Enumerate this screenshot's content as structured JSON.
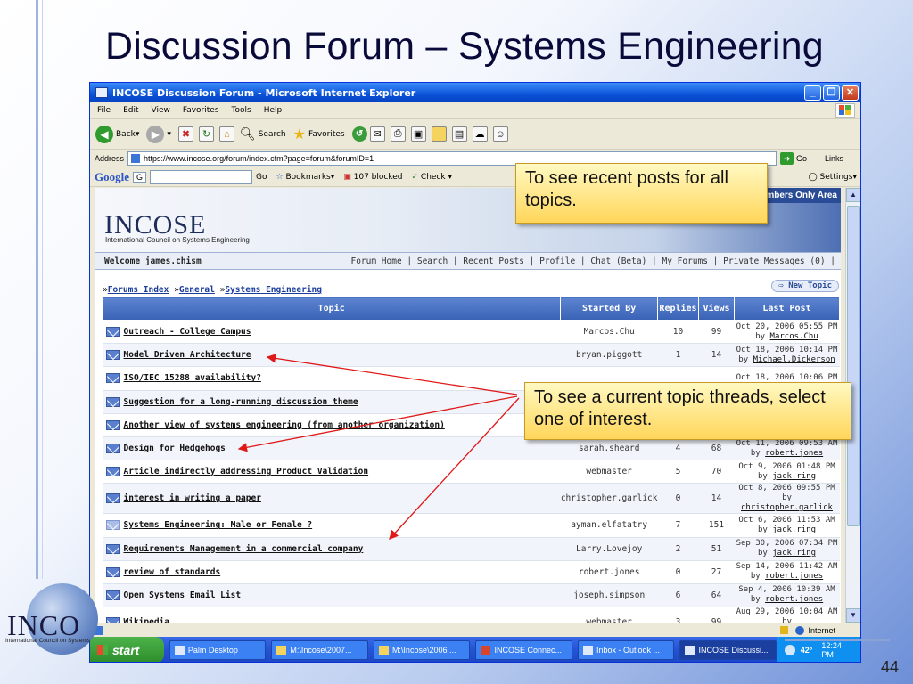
{
  "slide": {
    "title": "Discussion Forum – Systems Engineering",
    "page_number": "44",
    "logo_text": "INCO",
    "logo_subtitle": "International Council on Systems"
  },
  "browser": {
    "window_title": "INCOSE Discussion Forum - Microsoft Internet Explorer",
    "menu": [
      "File",
      "Edit",
      "View",
      "Favorites",
      "Tools",
      "Help"
    ],
    "toolbar": {
      "back": "Back",
      "search": "Search",
      "favorites": "Favorites"
    },
    "address_label": "Address",
    "address_url": "https://www.incose.org/forum/index.cfm?page=forum&forumID=1",
    "go_label": "Go",
    "links_label": "Links",
    "google": {
      "logo": "Google",
      "field_prefix": "G",
      "go": "Go",
      "bookmarks": "Bookmarks",
      "blocked": "107 blocked",
      "check": "Check",
      "settings": "Settings"
    }
  },
  "site": {
    "members_only": "Members Only Area",
    "logo": "INCOSE",
    "logo_subtitle": "International Council on Systems Engineering",
    "welcome": "Welcome james.chism",
    "nav_links": [
      "Forum Home",
      "Search",
      "Recent Posts",
      "Profile",
      "Chat (Beta)",
      "My Forums",
      "Private Messages"
    ],
    "private_count": "(0)",
    "breadcrumb": [
      "Forums Index",
      "General",
      "Systems Engineering"
    ],
    "new_topic": "New Topic",
    "columns": [
      "Topic",
      "Started By",
      "Replies",
      "Views",
      "Last Post"
    ],
    "topics": [
      {
        "title": "Outreach - College Campus",
        "started_by": "Marcos.Chu",
        "replies": "10",
        "views": "99",
        "last_date": "Oct 20, 2006 05:55 PM",
        "last_by": "Marcos.Chu",
        "read": false
      },
      {
        "title": "Model Driven Architecture",
        "started_by": "bryan.piggott",
        "replies": "1",
        "views": "14",
        "last_date": "Oct 18, 2006 10:14 PM",
        "last_by": "Michael.Dickerson",
        "read": false
      },
      {
        "title": "ISO/IEC 15288 availability?",
        "started_by": "",
        "replies": "",
        "views": "",
        "last_date": "Oct 18, 2006 10:06 PM",
        "last_by": "",
        "read": false
      },
      {
        "title": "Suggestion for a long-running discussion theme",
        "started_by": "",
        "replies": "",
        "views": "",
        "last_date": "",
        "last_by": "",
        "read": false
      },
      {
        "title": "Another view of systems engineering (from another organization)",
        "started_by": "",
        "replies": "",
        "views": "",
        "last_date": "",
        "last_by": "",
        "read": false
      },
      {
        "title": "Design for Hedgehogs",
        "started_by": "sarah.sheard",
        "replies": "4",
        "views": "68",
        "last_date": "Oct 11, 2006 09:53 AM",
        "last_by": "robert.jones",
        "read": false
      },
      {
        "title": "Article indirectly addressing Product Validation",
        "started_by": "webmaster",
        "replies": "5",
        "views": "70",
        "last_date": "Oct 9, 2006 01:48 PM",
        "last_by": "jack.ring",
        "read": false
      },
      {
        "title": "interest in writing a paper",
        "started_by": "christopher.garlick",
        "replies": "0",
        "views": "14",
        "last_date": "Oct 8, 2006 09:55 PM",
        "last_by": "christopher.garlick",
        "read": false
      },
      {
        "title": "Systems Engineering: Male or Female ?",
        "started_by": "ayman.elfatatry",
        "replies": "7",
        "views": "151",
        "last_date": "Oct 6, 2006 11:53 AM",
        "last_by": "jack.ring",
        "read": true
      },
      {
        "title": "Requirements Management in a commercial company",
        "started_by": "Larry.Lovejoy",
        "replies": "2",
        "views": "51",
        "last_date": "Sep 30, 2006 07:34 PM",
        "last_by": "jack.ring",
        "read": false
      },
      {
        "title": "review of standards",
        "started_by": "robert.jones",
        "replies": "0",
        "views": "27",
        "last_date": "Sep 14, 2006 11:42 AM",
        "last_by": "robert.jones",
        "read": false
      },
      {
        "title": "Open Systems Email List",
        "started_by": "joseph.simpson",
        "replies": "6",
        "views": "64",
        "last_date": "Sep 4, 2006 10:39 AM",
        "last_by": "robert.jones",
        "read": false
      },
      {
        "title": "Wikipedia",
        "started_by": "webmaster",
        "replies": "3",
        "views": "99",
        "last_date": "Aug 29, 2006 10:04 AM",
        "last_by": "christian.tulodieski",
        "read": false
      }
    ]
  },
  "statusbar": {
    "zone": "Internet"
  },
  "taskbar": {
    "start": "start",
    "items": [
      "Palm Desktop",
      "M:\\Incose\\2007...",
      "M:\\Incose\\2006 ...",
      "INCOSE Connec...",
      "Inbox - Outlook ...",
      "INCOSE Discussi..."
    ],
    "temp": "42°",
    "clock": "12:24 PM"
  },
  "callouts": {
    "recent": "To see recent posts for all topics.",
    "threads": "To see a current topic threads, select one of interest."
  }
}
